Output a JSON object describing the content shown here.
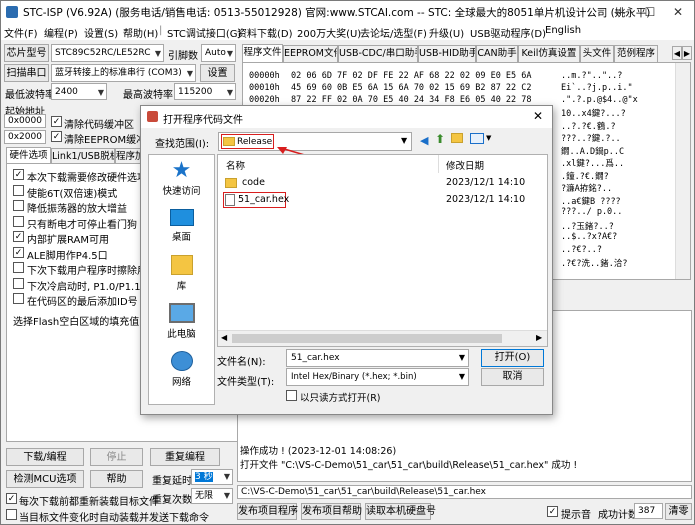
{
  "app": {
    "title": "STC-ISP (V6.92A) (服务电话/销售电话: 0513-55012928) 官网:www.STCAI.com -- STC: 全球最大的8051单片机设计公司 (姚永平)",
    "window_buttons": {
      "minimize": "—",
      "maximize": "☐",
      "close": "✕"
    }
  },
  "menu": [
    "文件(F)",
    "编程(P)",
    "设置(S)",
    "帮助(H)",
    "|",
    "STC调试接口(G)",
    "资料下载(D)",
    "200万大奖(U)",
    "去论坛/选型(F)",
    "升级(U)",
    "USB驱动程序(D)",
    "English"
  ],
  "left": {
    "chip_label": "芯片型号",
    "chip_value": "STC89C52RC/LE52RC",
    "pin_label": "引脚数",
    "pin_value": "Auto",
    "scan_button": "扫描串口",
    "port_value": "蓝牙转接上的标准串行 (COM3)",
    "settings_button": "设置",
    "min_baud_label": "最低波特率",
    "min_baud_value": "2400",
    "max_baud_label": "最高波特率",
    "max_baud_value": "115200",
    "start_addr_label": "起始地址",
    "code_addr": "0x0000",
    "eeprom_addr": "0x2000",
    "clear_code_label": "清除代码缓冲区",
    "clear_eeprom_label": "清除EEPROM缓冲区",
    "tabs": [
      "硬件选项",
      "Link1/USB脱机",
      "程序加"
    ],
    "options": [
      {
        "label": "本次下载需要修改硬件选项",
        "checked": true
      },
      {
        "label": "使能6T(双倍速)模式",
        "checked": false
      },
      {
        "label": "降低振荡器的放大增益",
        "checked": false
      },
      {
        "label": "只有断电才可停止看门狗",
        "checked": false
      },
      {
        "label": "内部扩展RAM可用",
        "checked": true
      },
      {
        "label": "ALE脚用作P4.5口",
        "checked": true
      },
      {
        "label": "下次下载用户程序时擦除用户",
        "checked": false
      },
      {
        "label": "下次冷启动时, P1.0/P1.1为0/",
        "checked": false
      },
      {
        "label": "在代码区的最后添加ID号",
        "checked": false
      }
    ],
    "fill_label": "选择Flash空白区域的填充值",
    "download_button": "下载/编程",
    "stop_button": "停止",
    "reprogram_button": "重复编程",
    "detect_button": "检测MCU选项",
    "help_button": "帮助",
    "repeat_delay_label": "重复延时",
    "repeat_delay_value": "3 秒",
    "repeat_count_label": "重复次数",
    "repeat_count_value": "无限",
    "reload_label": "每次下载前都重新装载目标文件",
    "auto_send_label": "当目标文件变化时自动装载并发送下载命令"
  },
  "right": {
    "tabs": [
      "程序文件",
      "EEPROM文件",
      "USB-CDC/串口助手",
      "USB-HID助手",
      "CAN助手",
      "Keil仿真设置",
      "头文件",
      "范例程序"
    ],
    "hex_rows": [
      {
        "addr": "00000h",
        "bytes": "02 06 6D 7F 02 DF FE 22 AF 68 22 02 09 E0 E5 6A",
        "ascii": "..m.?\"..\"..?"
      },
      {
        "addr": "00010h",
        "bytes": "45 69 60 0B E5 6A 15 6A 70 02 15 69 B2 87 22 C2",
        "ascii": "Ei`..?j.p..i.\""
      },
      {
        "addr": "00020h",
        "bytes": "87 22 FF 02 0A 70 E5 40 24 34 F8 E6 05 40 22 78",
        "ascii": ".\".?.p.@$4..@\"x"
      }
    ],
    "ascii_extra": [
      "10..x4鍵?...?",
      "..?.?€.鶴.?",
      "???..?鍵.?..",
      "鐗..A.D鍋p..C",
      ".xl鍵?...爲..",
      ".鐘.?€.鐗?",
      "?濂A拵銘?..",
      "..a€鍵B ????",
      "???../ p.0..",
      "..?玉鍺?..?",
      "..$..?x?A€?",
      "..?€?..?",
      ".?€?洗..鍺.洽?"
    ],
    "log_lines": [
      "操作成功 ! (2023-12-01 14:08:26)",
      "打开文件 \"C:\\VS-C-Demo\\51_car\\51_car\\build\\Release\\51_car.hex\" 成功 !"
    ],
    "path_value": "C:\\VS-C-Demo\\51_car\\51_car\\build\\Release\\51_car.hex",
    "hint_label": "提示音",
    "count_label": "成功计数",
    "count_value": "387",
    "clear_button": "清零"
  },
  "bottom": {
    "b1": "发布项目程序",
    "b2": "发布项目帮助",
    "b3": "读取本机硬盘号"
  },
  "dialog": {
    "title": "打开程序代码文件",
    "lookin_label": "查找范围(I):",
    "lookin_value": "Release",
    "col_name": "名称",
    "col_date": "修改日期",
    "files": [
      {
        "name": "code",
        "date": "2023/12/1 14:10",
        "type": "folder"
      },
      {
        "name": "51_car.hex",
        "date": "2023/12/1 14:10",
        "type": "file"
      }
    ],
    "places": [
      "快速访问",
      "桌面",
      "库",
      "此电脑",
      "网络"
    ],
    "filename_label": "文件名(N):",
    "filename_value": "51_car.hex",
    "filetype_label": "文件类型(T):",
    "filetype_value": "Intel Hex/Binary (*.hex; *.bin)",
    "readonly_label": "以只读方式打开(R)",
    "open_button": "打开(O)",
    "cancel_button": "取消"
  },
  "colors": {
    "accent": "#0078d7",
    "highlight": "#d81e1e",
    "folder": "#f4c542"
  }
}
